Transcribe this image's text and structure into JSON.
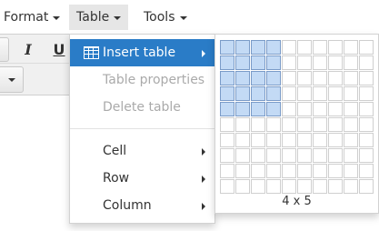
{
  "menubar": {
    "items": [
      {
        "label": "Format"
      },
      {
        "label": "Table"
      },
      {
        "label": "Tools"
      }
    ]
  },
  "toolbar": {
    "italic_label": "I",
    "underline_label": "U"
  },
  "table_menu": {
    "items": [
      {
        "label": "Insert table",
        "icon": "table-icon"
      },
      {
        "label": "Table properties"
      },
      {
        "label": "Delete table"
      },
      {
        "label": "Cell"
      },
      {
        "label": "Row"
      },
      {
        "label": "Column"
      }
    ]
  },
  "grid_picker": {
    "columns": 10,
    "rows": 10,
    "selected_cols": 4,
    "selected_rows": 5,
    "label": "4 x 5"
  },
  "colors": {
    "accent": "#2a7cc7",
    "grid_selected": "#c3daf5"
  }
}
